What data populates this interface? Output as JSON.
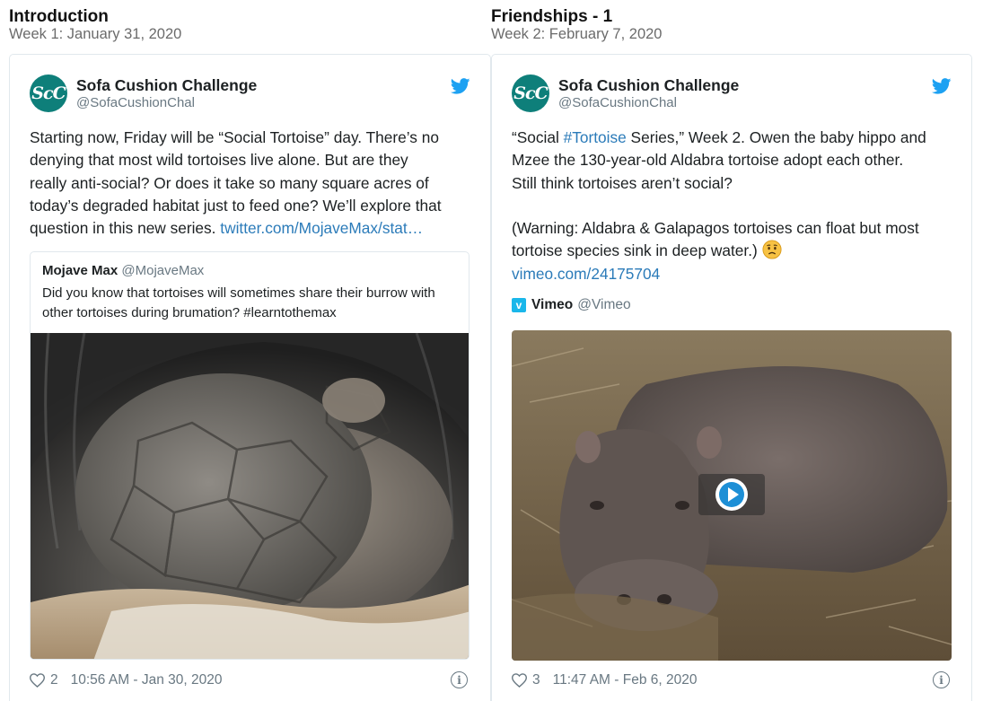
{
  "sections": [
    {
      "title": "Introduction",
      "subtitle": "Week 1: January 31, 2020",
      "tweet": {
        "author_name": "Sofa Cushion Challenge",
        "author_handle": "@SofaCushionChal",
        "avatar_text": "ScC",
        "text_lines": [
          "Starting now, Friday will be “Social Tortoise” day.  There’s no",
          "denying that most wild tortoises live alone.  But are they",
          "really anti-social?  Or does it take so many square acres of",
          "today’s degraded habitat just to feed one?  We’ll explore that",
          "question in this new series. "
        ],
        "link_text": "twitter.com/MojaveMax/stat…",
        "quote": {
          "name": "Mojave Max",
          "handle": "@MojaveMax",
          "text": "Did you know that tortoises will sometimes share their burrow with other tortoises during brumation? #learntothemax",
          "image_icon": "tortoises-in-burrow-photo"
        },
        "likes": "2",
        "timestamp": "10:56 AM - Jan 30, 2020"
      }
    },
    {
      "title": "Friendships - 1",
      "subtitle": "Week 2: February 7, 2020",
      "tweet": {
        "author_name": "Sofa Cushion Challenge",
        "author_handle": "@SofaCushionChal",
        "avatar_text": "ScC",
        "line1_pre": "“Social ",
        "hashtag": "#Tortoise",
        "line1_post": " Series,” Week 2.  Owen the baby hippo and",
        "line2": "Mzee the 130-year-old Aldabra tortoise adopt each other.",
        "line3": "Still think tortoises aren’t social?",
        "line5": "(Warning: Aldabra & Galapagos tortoises can float but most",
        "line6": "tortoise species sink in deep water.) ",
        "emoji_icon": "worried-face-icon",
        "link_text": "vimeo.com/24175704",
        "embed": {
          "provider_name": "Vimeo",
          "provider_handle": "@Vimeo",
          "logo_letter": "v",
          "video_icon": "baby-hippo-video-thumbnail"
        },
        "likes": "3",
        "timestamp": "11:47 AM - Feb 6, 2020"
      }
    }
  ],
  "colors": {
    "link": "#2b7bb9",
    "twitter_blue": "#1da1f2",
    "avatar_bg": "#0e7f7a",
    "muted": "#697882",
    "vimeo": "#1ab7ea"
  }
}
